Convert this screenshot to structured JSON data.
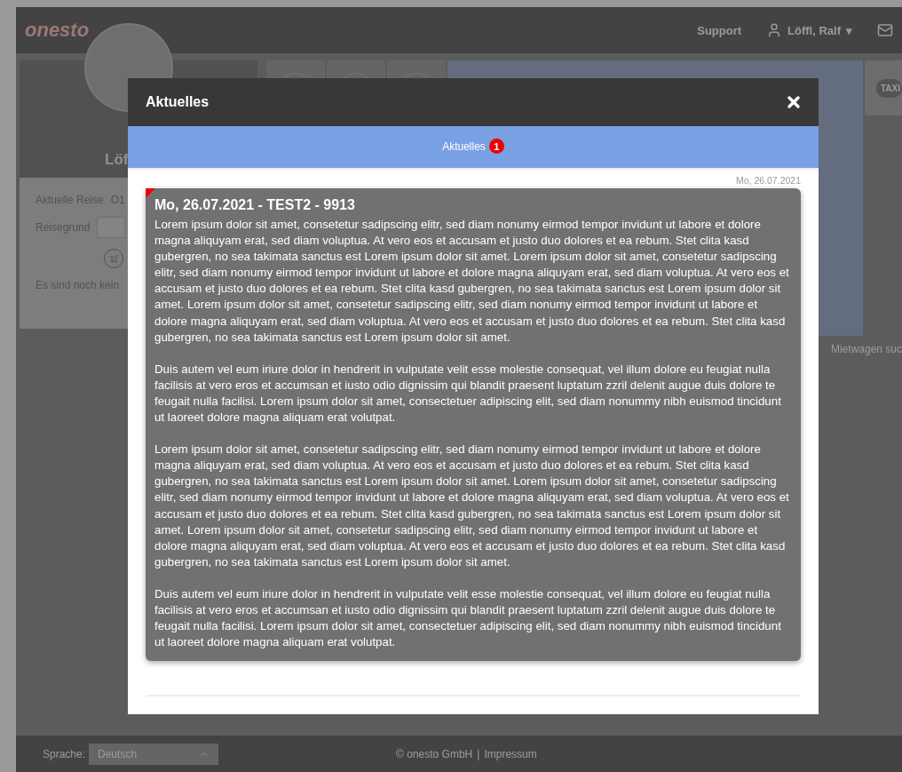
{
  "header": {
    "logo": "onesto",
    "links": [
      "Support"
    ],
    "user": {
      "name": "Löffl, Ralf",
      "caret": "▾"
    }
  },
  "profile": {
    "name": "Löf",
    "fields": [
      {
        "label": "Aktuelle Reise",
        "value": "O1"
      },
      {
        "label": "Reisegrund"
      }
    ],
    "notice": "Es sind noch kein"
  },
  "side_tile": {
    "label": "TAXI"
  },
  "search_label": "Mietwagen suc",
  "footer": {
    "language_label": "Sprache:",
    "language": "Deutsch",
    "copyright": "© onesto GmbH",
    "separator": "|",
    "link": "Impressum"
  },
  "modal": {
    "title": "Aktuelles",
    "tabs": [
      {
        "label": "Aktuelles",
        "count": "1",
        "selected": true
      }
    ],
    "date": "Mo, 26.07.2021",
    "news": [
      {
        "title": "Mo, 26.07.2021 - TEST2 - 9913",
        "unread": true,
        "paragraphs": [
          "Lorem ipsum dolor sit amet, consetetur sadipscing elitr, sed diam nonumy eirmod tempor invidunt ut labore et dolore magna aliquyam erat, sed diam voluptua. At vero eos et accusam et justo duo dolores et ea rebum. Stet clita kasd gubergren, no sea takimata sanctus est Lorem ipsum dolor sit amet. Lorem ipsum dolor sit amet, consetetur sadipscing elitr, sed diam nonumy eirmod tempor invidunt ut labore et dolore magna aliquyam erat, sed diam voluptua. At vero eos et accusam et justo duo dolores et ea rebum. Stet clita kasd gubergren, no sea takimata sanctus est Lorem ipsum dolor sit amet. Lorem ipsum dolor sit amet, consetetur sadipscing elitr, sed diam nonumy eirmod tempor invidunt ut labore et dolore magna aliquyam erat, sed diam voluptua. At vero eos et accusam et justo duo dolores et ea rebum. Stet clita kasd gubergren, no sea takimata sanctus est Lorem ipsum dolor sit amet.",
          "Duis autem vel eum iriure dolor in hendrerit in vulputate velit esse molestie consequat, vel illum dolore eu feugiat nulla facilisis at vero eros et accumsan et iusto odio dignissim qui blandit praesent luptatum zzril delenit augue duis dolore te feugait nulla facilisi. Lorem ipsum dolor sit amet, consectetuer adipiscing elit, sed diam nonummy nibh euismod tincidunt ut laoreet dolore magna aliquam erat volutpat.",
          "Lorem ipsum dolor sit amet, consetetur sadipscing elitr, sed diam nonumy eirmod tempor invidunt ut labore et dolore magna aliquyam erat, sed diam voluptua. At vero eos et accusam et justo duo dolores et ea rebum. Stet clita kasd gubergren, no sea takimata sanctus est Lorem ipsum dolor sit amet. Lorem ipsum dolor sit amet, consetetur sadipscing elitr, sed diam nonumy eirmod tempor invidunt ut labore et dolore magna aliquyam erat, sed diam voluptua. At vero eos et accusam et justo duo dolores et ea rebum. Stet clita kasd gubergren, no sea takimata sanctus est Lorem ipsum dolor sit amet. Lorem ipsum dolor sit amet, consetetur sadipscing elitr, sed diam nonumy eirmod tempor invidunt ut labore et dolore magna aliquyam erat, sed diam voluptua. At vero eos et accusam et justo duo dolores et ea rebum. Stet clita kasd gubergren, no sea takimata sanctus est Lorem ipsum dolor sit amet.",
          "Duis autem vel eum iriure dolor in hendrerit in vulputate velit esse molestie consequat, vel illum dolore eu feugiat nulla facilisis at vero eros et accumsan et iusto odio dignissim qui blandit praesent luptatum zzril delenit augue duis dolore te feugait nulla facilisi. Lorem ipsum dolor sit amet, consectetuer adipiscing elit, sed diam nonummy nibh euismod tincidunt ut laoreet dolore magna aliquam erat volutpat."
        ]
      }
    ]
  }
}
